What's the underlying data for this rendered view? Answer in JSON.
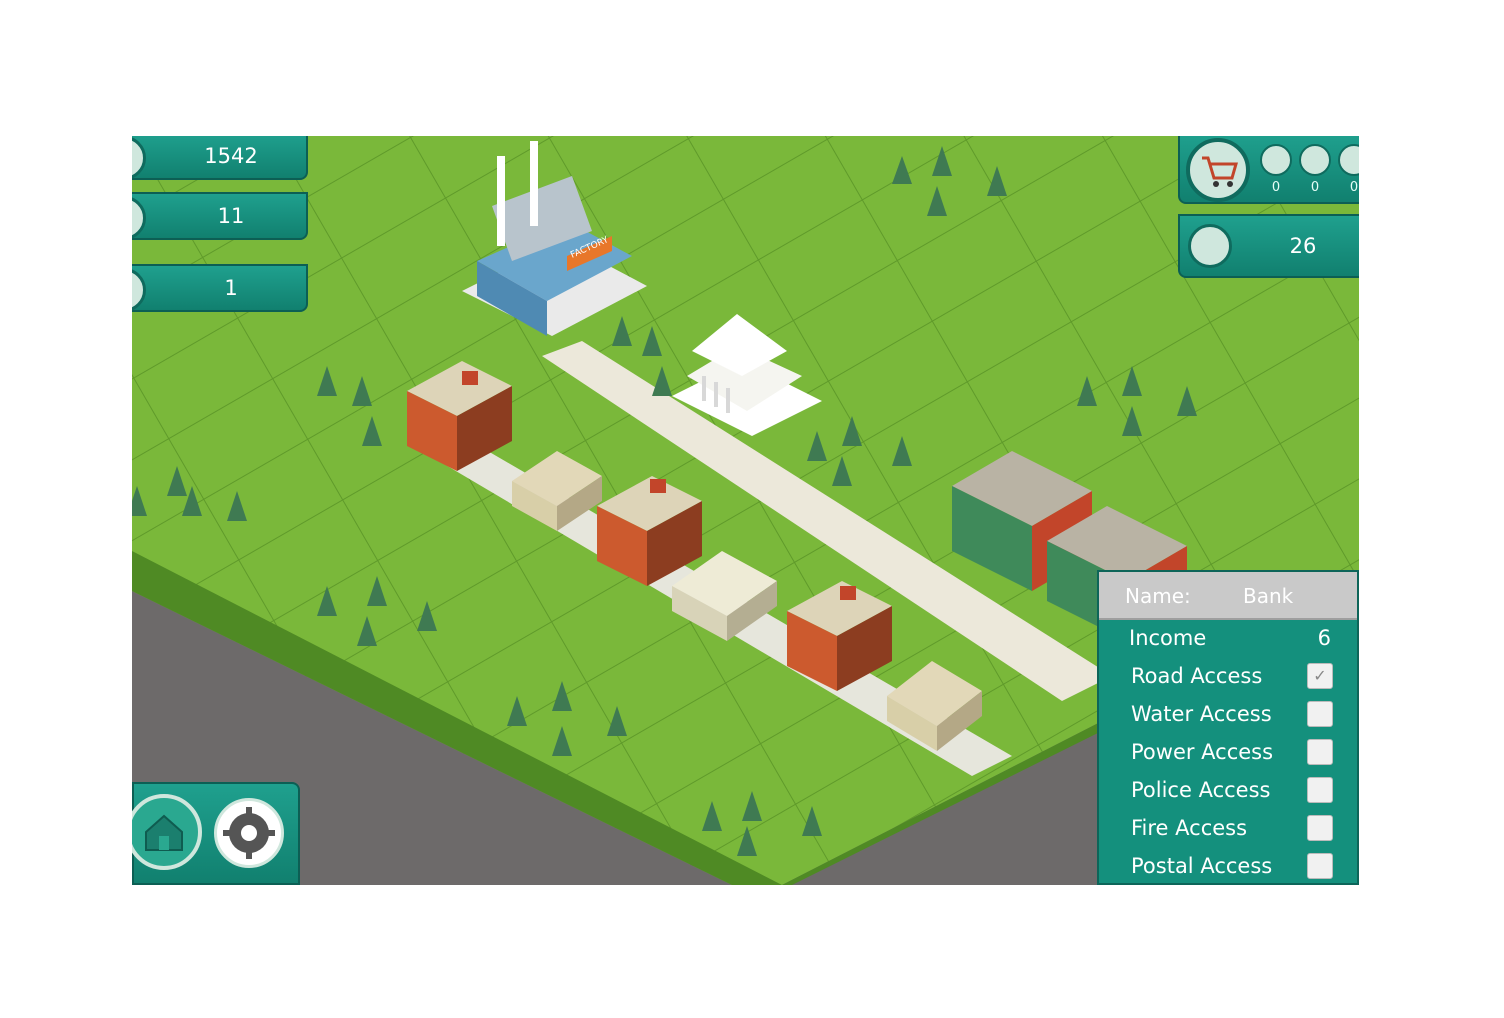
{
  "resources": {
    "money": {
      "value": "1542",
      "icon": "money-bag-icon"
    },
    "workers": {
      "value": "11",
      "icon": "worker-icon"
    },
    "tools": {
      "value": "1",
      "icon": "toolbox-icon"
    }
  },
  "shop": {
    "icon": "shopping-cart-icon",
    "items": [
      {
        "icon": "money-bag-icon",
        "count": "0"
      },
      {
        "icon": "worker-icon",
        "count": "0"
      },
      {
        "icon": "wrench-icon",
        "count": "0"
      }
    ]
  },
  "population": {
    "value": "26",
    "icon": "citizens-icon"
  },
  "building_info": {
    "name_label": "Name:",
    "name_value": "Bank",
    "income_label": "Income",
    "income_value": "6",
    "access": [
      {
        "label": "Road Access",
        "checked": true
      },
      {
        "label": "Water Access",
        "checked": false
      },
      {
        "label": "Power Access",
        "checked": false
      },
      {
        "label": "Police Access",
        "checked": false
      },
      {
        "label": "Fire Access",
        "checked": false
      },
      {
        "label": "Postal Access",
        "checked": false
      }
    ]
  },
  "scene": {
    "factory_sign": "FACTORY"
  },
  "controls": {
    "home_icon": "home-icon",
    "settings_icon": "gear-icon"
  },
  "colors": {
    "hud": "#14907d",
    "grass": "#7ab83a",
    "road": "#ece8da",
    "ground": "#6d6a6a"
  }
}
